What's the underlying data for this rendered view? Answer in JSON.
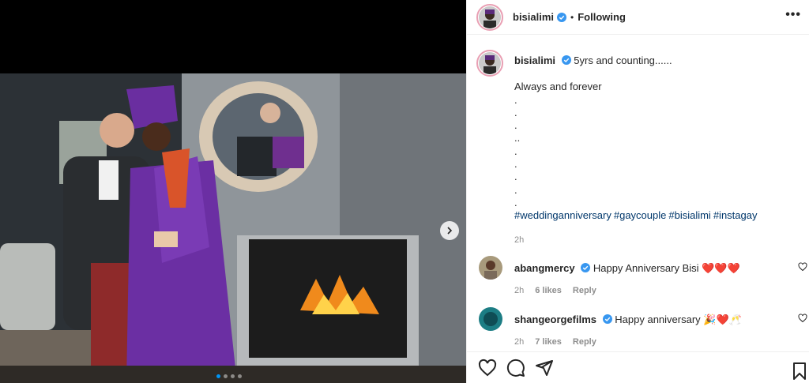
{
  "post": {
    "username": "bisialimi",
    "follow_status": "Following",
    "separator": "•",
    "more": "•••",
    "carousel": {
      "slides": 4,
      "active": 0
    }
  },
  "caption": {
    "username": "bisialimi",
    "first_line": "5yrs and counting......",
    "lines": [
      "Always and forever",
      ".",
      ".",
      ".",
      "..",
      ".",
      ".",
      ".",
      ".",
      "."
    ],
    "hashtags": [
      "#weddinganniversary",
      "#gaycouple",
      "#bisialimi",
      "#instagay"
    ],
    "time": "2h"
  },
  "comments": [
    {
      "username": "abangmercy",
      "text": "Happy Anniversary Bisi",
      "emoji": "❤️❤️❤️",
      "time": "2h",
      "likes": "6 likes",
      "reply": "Reply"
    },
    {
      "username": "shangeorgefilms",
      "text": "Happy anniversary",
      "emoji": "🎉❤️🥂",
      "time": "2h",
      "likes": "7 likes",
      "reply": "Reply"
    }
  ],
  "icons": {
    "like": "heart-icon",
    "comment": "comment-icon",
    "share": "share-icon",
    "save": "bookmark-icon",
    "next": "chevron-right-icon",
    "verified": "verified-badge-icon"
  },
  "colors": {
    "link": "#00376b",
    "verified": "#3897f0",
    "muted": "#8e8e8e",
    "text": "#262626"
  }
}
